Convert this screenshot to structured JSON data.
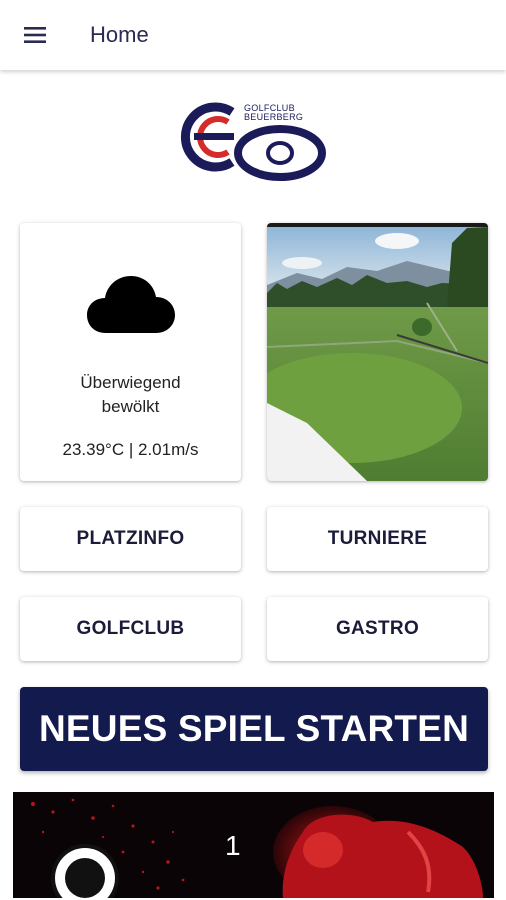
{
  "appbar": {
    "title": "Home",
    "menu_icon": "menu-icon"
  },
  "logo": {
    "line1": "GOLFCLUB",
    "line2": "BEUERBERG",
    "colors": {
      "navy": "#1b1b5a",
      "red": "#d62b2b"
    }
  },
  "weather": {
    "icon": "cloud-icon",
    "description": "Überwiegend bewölkt",
    "data": "23.39°C | 2.01m/s"
  },
  "buttons": {
    "platzinfo": "PLATZINFO",
    "turniere": "TURNIERE",
    "golfclub": "GOLFCLUB",
    "gastro": "GASTRO"
  },
  "cta": {
    "label": "NEUES SPIEL STARTEN",
    "color": "#131a4d"
  },
  "promo": {
    "counter": "1"
  }
}
